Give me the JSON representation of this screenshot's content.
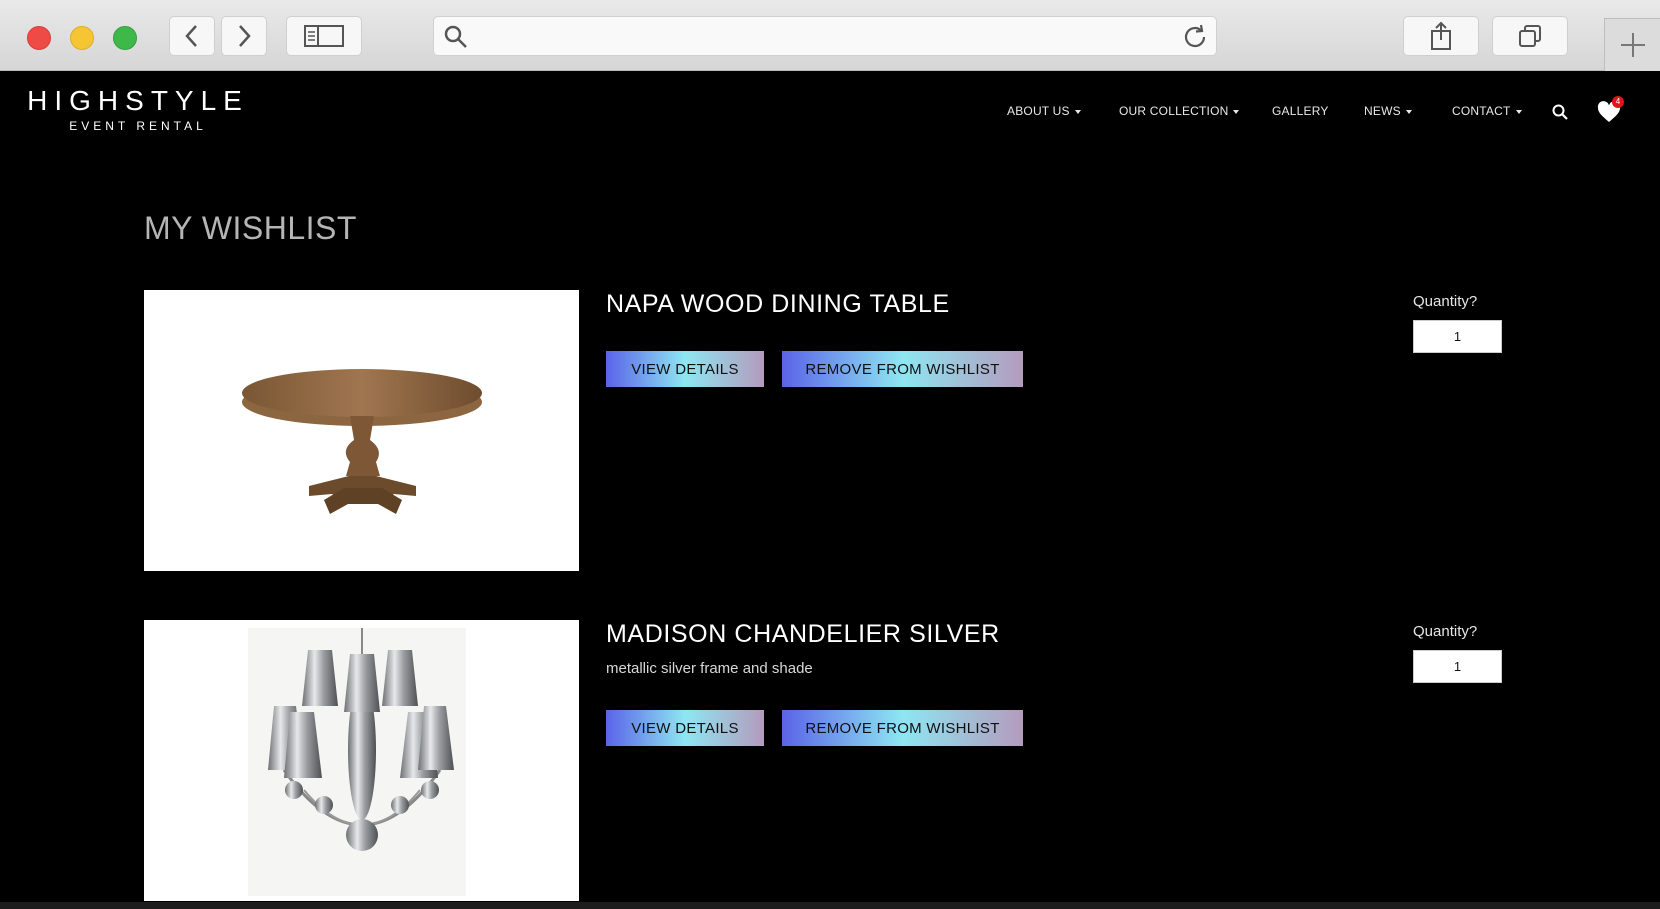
{
  "browser": {
    "url_text": ""
  },
  "site": {
    "logo_main": "HIGHSTYLE",
    "logo_sub": "EVENT RENTAL",
    "nav": [
      {
        "label": "ABOUT US",
        "dropdown": true
      },
      {
        "label": "OUR COLLECTION",
        "dropdown": true
      },
      {
        "label": "GALLERY",
        "dropdown": false
      },
      {
        "label": "NEWS",
        "dropdown": true
      },
      {
        "label": "CONTACT",
        "dropdown": true
      }
    ],
    "wishlist_count": "4"
  },
  "page": {
    "title": "MY WISHLIST"
  },
  "items": [
    {
      "name": "NAPA WOOD DINING TABLE",
      "description": "",
      "image": "round-wood-pedestal-table",
      "view_label": "VIEW DETAILS",
      "remove_label": "REMOVE FROM WISHLIST",
      "quantity_label": "Quantity?",
      "quantity": "1"
    },
    {
      "name": "MADISON CHANDELIER SILVER",
      "description": "metallic silver frame and shade",
      "image": "silver-chandelier",
      "view_label": "VIEW DETAILS",
      "remove_label": "REMOVE FROM WISHLIST",
      "quantity_label": "Quantity?",
      "quantity": "1"
    }
  ],
  "colors": {
    "background": "#000000",
    "button_gradient_start": "#5a63e8",
    "button_gradient_mid": "#8ee6f2",
    "button_gradient_end": "#b49bbd",
    "badge": "#e3131b"
  }
}
